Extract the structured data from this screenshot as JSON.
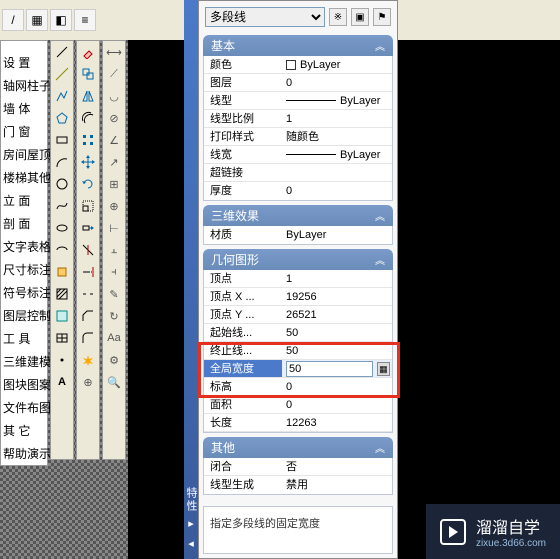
{
  "top_icons": [
    "⊕",
    "▦",
    "◧",
    "≡",
    "▲",
    "▣",
    "⬚",
    "◐",
    "◑",
    "◒",
    "◓",
    "◇",
    "◈",
    "✦",
    "▭",
    "◻",
    "◼",
    "▤",
    "▥",
    "▨",
    "▧",
    "◫",
    "◪",
    "⬒",
    "⬓",
    "◰",
    "◱",
    "◲",
    "◳"
  ],
  "left_labels": [
    "设 置",
    "轴网柱子",
    "墙 体",
    "门 窗",
    "房间屋顶",
    "楼梯其他",
    "立 面",
    "剖 面",
    "文字表格",
    "尺寸标注",
    "符号标注",
    "图层控制",
    "工 具",
    "三维建模",
    "图块图案",
    "文件布图",
    "其 它",
    "帮助演示"
  ],
  "draw_tools_1": [
    "line",
    "cline",
    "pline",
    "poly",
    "rect",
    "arc",
    "circle",
    "spline",
    "ellipse",
    "earc",
    "ins",
    "hatch",
    "region",
    "table",
    "mtext",
    "A"
  ],
  "draw_tools_2": [
    "erase",
    "copy",
    "mirror",
    "offset",
    "array",
    "move",
    "rotate",
    "scale",
    "stretch",
    "trim",
    "extend",
    "break",
    "join",
    "chamfer",
    "fillet",
    "explode"
  ],
  "draw_tools_3": [
    "dim",
    "dima",
    "dimr",
    "dimd",
    "dimo",
    "leader",
    "tol",
    "cen",
    "ord",
    "bas",
    "cont",
    "edit",
    "update",
    "style",
    "over",
    "insp"
  ],
  "spine": {
    "label": "特性"
  },
  "selector": {
    "value": "多段线"
  },
  "sections": {
    "basic": {
      "title": "基本",
      "rows": {
        "color_k": "颜色",
        "color_v": "ByLayer",
        "layer_k": "图层",
        "layer_v": "0",
        "ltype_k": "线型",
        "ltype_v": "ByLayer",
        "lscale_k": "线型比例",
        "lscale_v": "1",
        "pstyle_k": "打印样式",
        "pstyle_v": "随颜色",
        "lweight_k": "线宽",
        "lweight_v": "ByLayer",
        "hyper_k": "超链接",
        "hyper_v": "",
        "thick_k": "厚度",
        "thick_v": "0"
      }
    },
    "threeD": {
      "title": "三维效果",
      "rows": {
        "mat_k": "材质",
        "mat_v": "ByLayer"
      }
    },
    "geom": {
      "title": "几何图形",
      "rows": {
        "vtx_k": "顶点",
        "vtx_v": "1",
        "vx_k": "顶点 X ...",
        "vx_v": "19256",
        "vy_k": "顶点 Y ...",
        "vy_v": "26521",
        "sw_k": "起始线...",
        "sw_v": "50",
        "ew_k": "终止线...",
        "ew_v": "50",
        "gw_k": "全局宽度",
        "gw_v": "50",
        "elev_k": "标高",
        "elev_v": "0",
        "area_k": "面积",
        "area_v": "0",
        "len_k": "长度",
        "len_v": "12263"
      }
    },
    "misc": {
      "title": "其他",
      "rows": {
        "closed_k": "闭合",
        "closed_v": "否",
        "lgen_k": "线型生成",
        "lgen_v": "禁用"
      }
    }
  },
  "hint": "指定多段线的固定宽度",
  "watermark": {
    "brand": "溜溜自学",
    "url": "zixue.3d66.com"
  }
}
